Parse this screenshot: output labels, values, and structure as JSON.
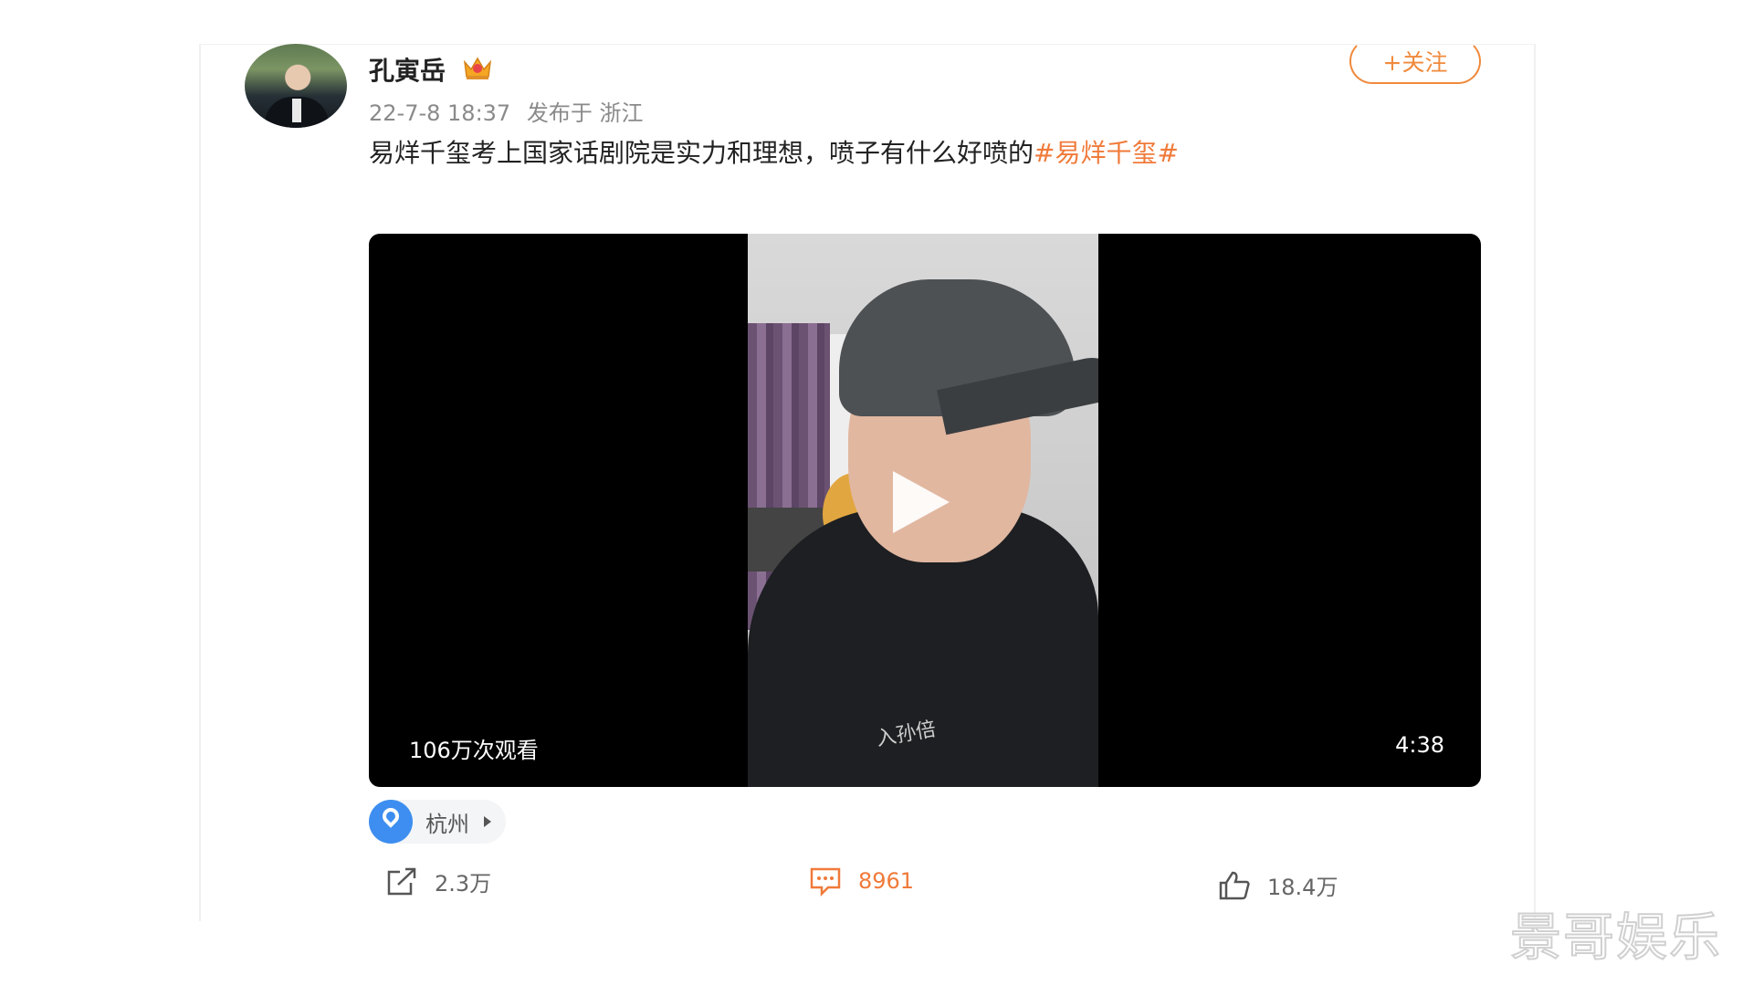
{
  "user": {
    "name": "孔寅岳",
    "badge_icon": "crown-icon",
    "follow_label": "+关注"
  },
  "meta": {
    "timestamp": "22-7-8 18:37",
    "published_in": "发布于 浙江"
  },
  "post": {
    "text": "易烊千玺考上国家话剧院是实力和理想，喷子有什么好喷的",
    "hashtag": "#易烊千玺#"
  },
  "video": {
    "views": "106万次观看",
    "duration": "4:38",
    "shirt_text": "入孙倍"
  },
  "location": {
    "name": "杭州"
  },
  "actions": {
    "share_count": "2.3万",
    "comment_count": "8961",
    "like_count": "18.4万"
  },
  "watermark": "景哥娱乐",
  "colors": {
    "accent": "#f07a3a",
    "location_blue": "#3d8ef0"
  }
}
